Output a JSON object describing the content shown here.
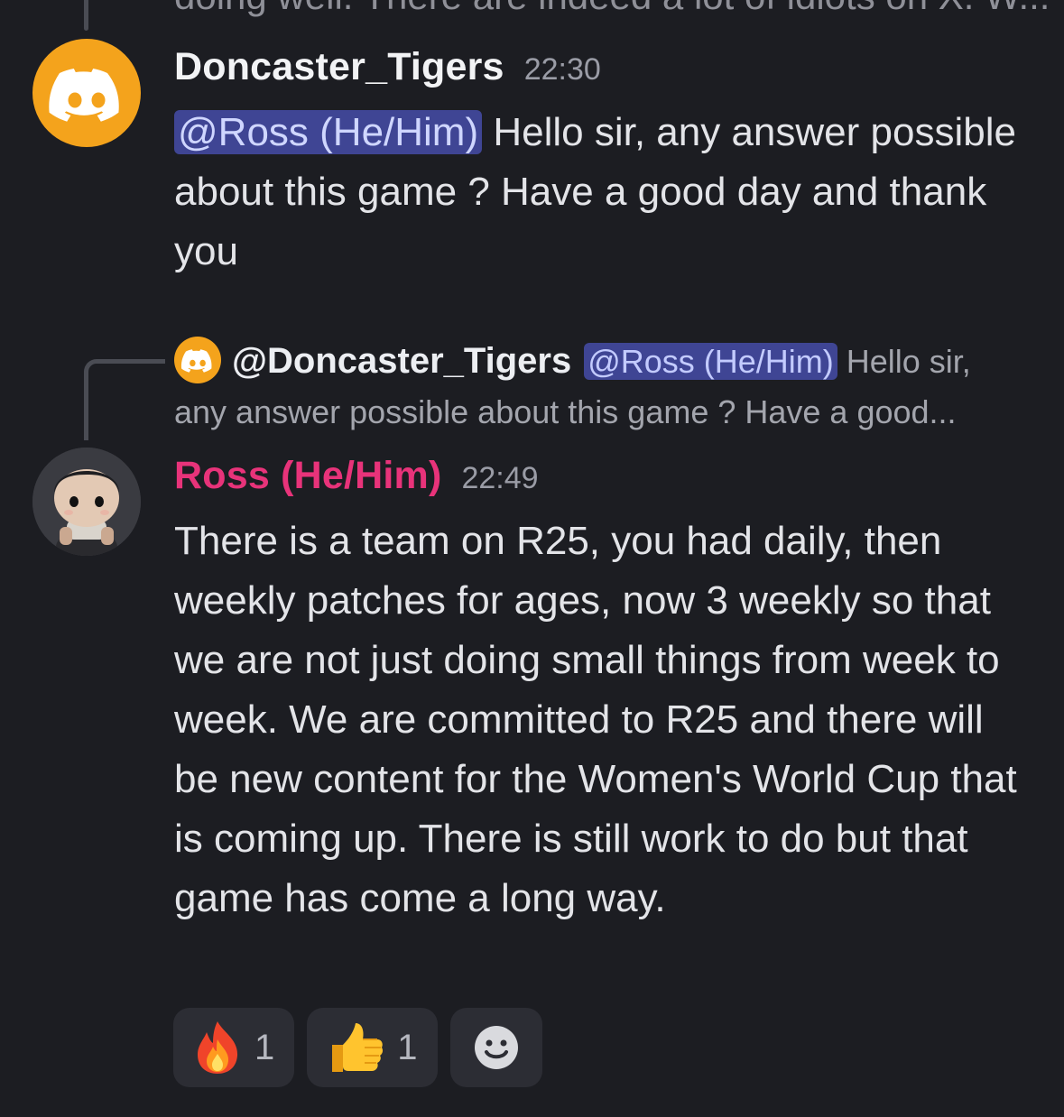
{
  "previous_message": {
    "cut_text": "doing well. There are indeed  a lot of idiots on X.  W..."
  },
  "message1": {
    "author": "Doncaster_Tigers",
    "time": "22:30",
    "mention": "@Ross (He/Him)",
    "text": " Hello sir, any answer possible about this game ? Have a good day and thank you",
    "avatar_icon": "discord-logo-icon",
    "avatar_color": "#f4a31c"
  },
  "reply_preview": {
    "author": "@Doncaster_Tigers",
    "mention": "@Ross (He/Him)",
    "line1_text": " Hello sir,",
    "line2_text": "any answer possible about this game ? Have a good..."
  },
  "message2": {
    "author": "Ross (He/Him)",
    "author_color": "#e8337a",
    "time": "22:49",
    "text": "There is a team on R25, you had daily, then weekly patches for ages, now 3 weekly so that we are not just doing small things from week to week. We are committed to R25 and there will be new content for the Women's World Cup that is coming up. There is still work to do but that game has come a long way."
  },
  "reactions": [
    {
      "emoji": "fire-icon",
      "count": "1"
    },
    {
      "emoji": "thumbs-up-icon",
      "count": "1"
    }
  ],
  "add_reaction_icon": "add-reaction-icon"
}
